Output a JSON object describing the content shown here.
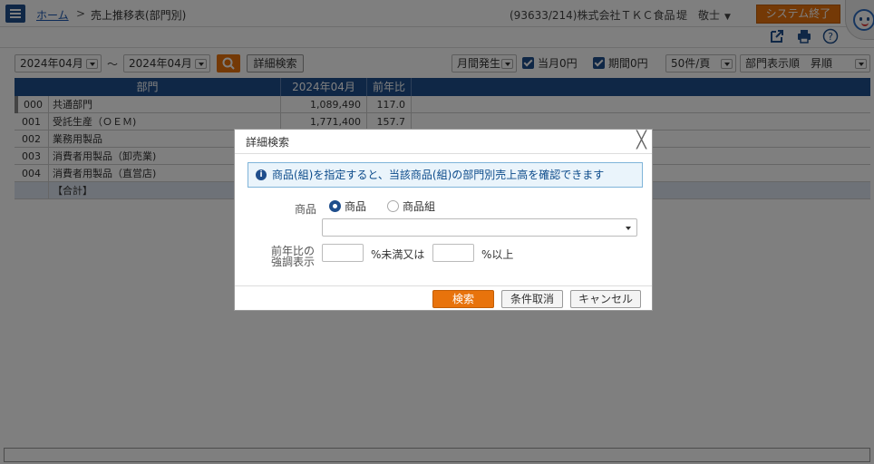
{
  "header": {
    "breadcrumb_home": "ホーム",
    "breadcrumb_sep": ">",
    "breadcrumb_current": "売上推移表(部門別)",
    "company": "(93633/214)株式会社ＴＫＣ食品",
    "user": "堤　敬士",
    "exit_button": "システム終了"
  },
  "toolbar_icons": [
    "external-link-icon",
    "print-icon",
    "help-icon"
  ],
  "filters": {
    "period_from": "2024年04月",
    "range_sep": "～",
    "period_to": "2024年04月",
    "detail_search": "詳細検索",
    "occurrence": "月間発生",
    "current_zero": "当月0円",
    "period_zero": "期間0円",
    "page_size": "50件/頁",
    "sort": "部門表示順　昇順"
  },
  "table": {
    "headers": [
      "部門",
      "2024年04月",
      "前年比"
    ],
    "rows": [
      {
        "code": "000",
        "name": "共通部門",
        "value": "1,089,490",
        "ratio": "117.0"
      },
      {
        "code": "001",
        "name": "受託生産（ＯＥＭ)",
        "value": "1,771,400",
        "ratio": "157.7"
      },
      {
        "code": "002",
        "name": "業務用製品",
        "value": "",
        "ratio": ""
      },
      {
        "code": "003",
        "name": "消費者用製品（卸売業)",
        "value": "",
        "ratio": ""
      },
      {
        "code": "004",
        "name": "消費者用製品（直営店)",
        "value": "",
        "ratio": ""
      }
    ],
    "total_label": "【合計】"
  },
  "modal": {
    "title": "詳細検索",
    "close": "╳",
    "info_icon": "i",
    "info_text": "商品(組)を指定すると、当該商品(組)の部門別売上高を確認できます",
    "product_label": "商品",
    "radio_product": "商品",
    "radio_group": "商品組",
    "highlight_label_line1": "前年比の",
    "highlight_label_line2": "強調表示",
    "under_text": "%未満又は",
    "over_text": "%以上",
    "search_button": "検索",
    "clear_button": "条件取消",
    "cancel_button": "キャンセル"
  },
  "colors": {
    "navy": "#1f4e8c",
    "orange": "#e8730c",
    "info_bg": "#eaf4fb"
  }
}
